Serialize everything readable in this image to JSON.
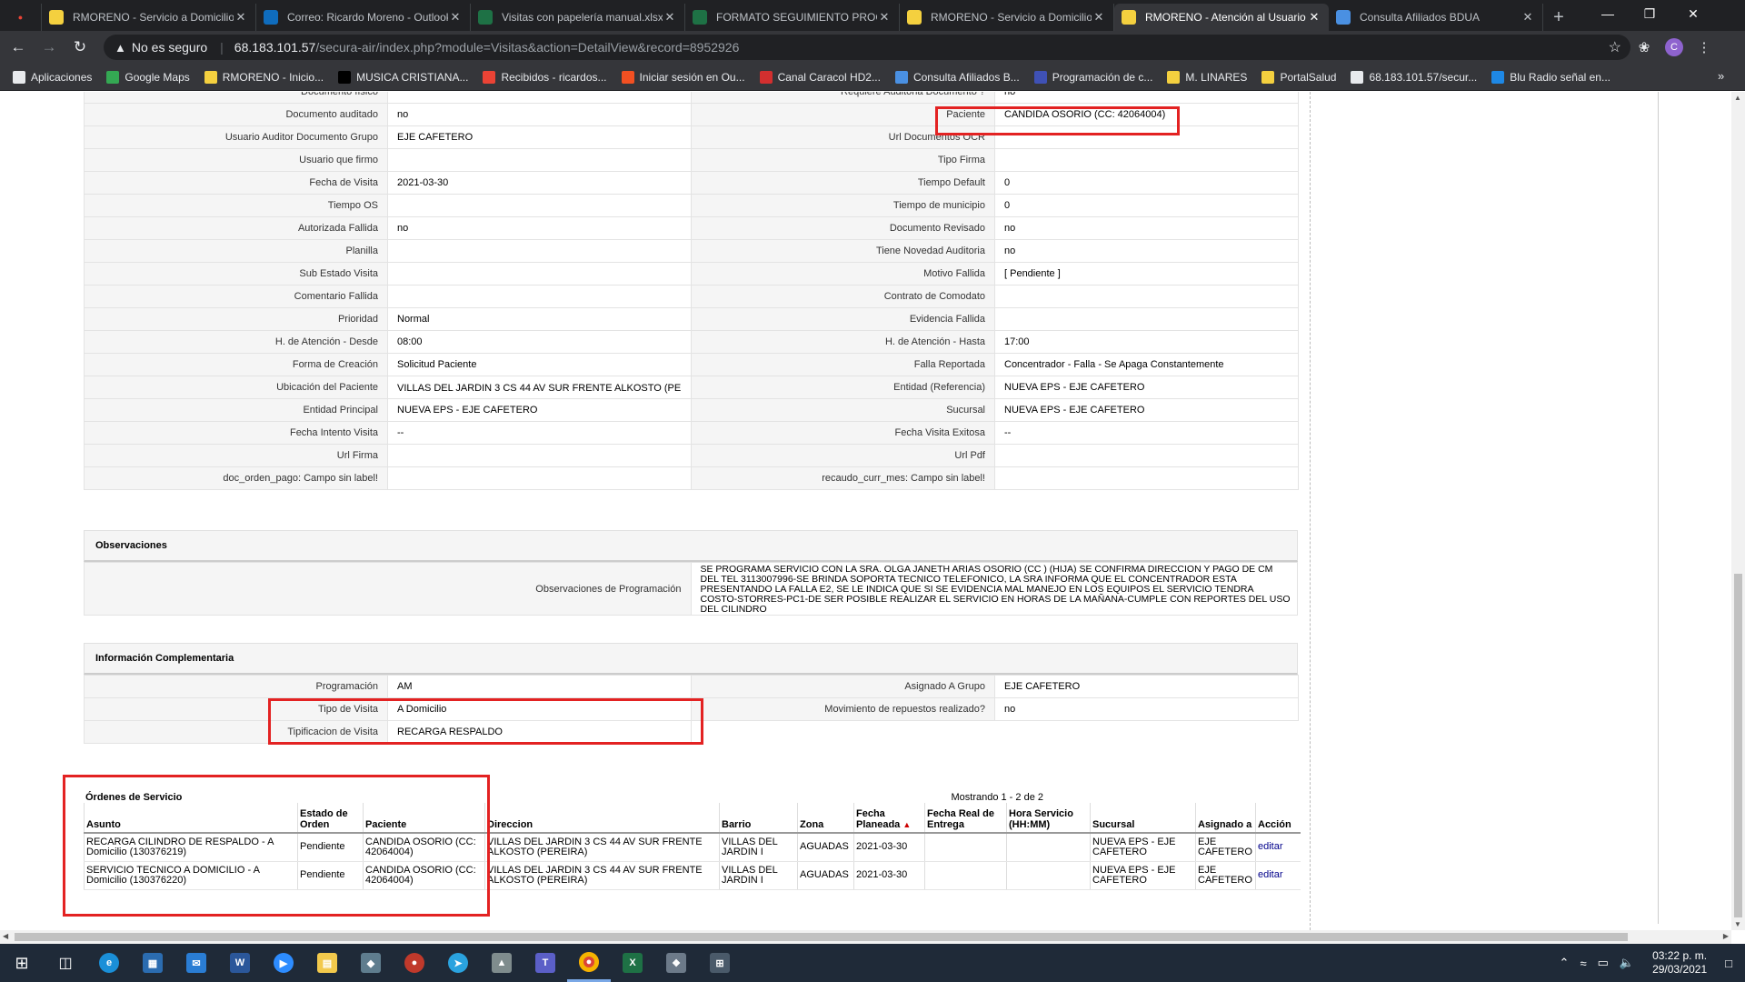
{
  "browser": {
    "tabs": [
      {
        "title": "RMORENO - Servicio a Domicilio",
        "icon": "yellow-logo",
        "color": "#f4d03f",
        "active": false
      },
      {
        "title": "Correo: Ricardo Moreno - Outlook",
        "icon": "outlook",
        "color": "#0f6cbd",
        "active": false
      },
      {
        "title": "Visitas con papelería manual.xlsx",
        "icon": "excel",
        "color": "#1e7145",
        "active": false
      },
      {
        "title": "FORMATO SEGUIMIENTO PROGRAMACIÓN",
        "icon": "excel",
        "color": "#1e7145",
        "active": false
      },
      {
        "title": "RMORENO - Servicio a Domicilio",
        "icon": "yellow-logo",
        "color": "#f4d03f",
        "active": false
      },
      {
        "title": "RMORENO - Atención al Usuario",
        "icon": "yellow-logo",
        "color": "#f4d03f",
        "active": true
      },
      {
        "title": "Consulta Afiliados BDUA",
        "icon": "adres",
        "color": "#4a90e2",
        "active": false
      }
    ],
    "address": {
      "security": "No es seguro",
      "host": "68.183.101.57",
      "path": "/secura-air/index.php?module=Visitas&action=DetailView&record=8952926"
    },
    "profile_initial": "C",
    "bookmarks": [
      {
        "label": "Aplicaciones",
        "icon": "apps-icon",
        "color": "#e8eaed"
      },
      {
        "label": "Google Maps",
        "icon": "maps-icon",
        "color": "#34a853"
      },
      {
        "label": "RMORENO - Inicio...",
        "icon": "yellow-logo",
        "color": "#f4d03f"
      },
      {
        "label": "MUSICA CRISTIANA...",
        "icon": "music-icon",
        "color": "#000000"
      },
      {
        "label": "Recibidos - ricardos...",
        "icon": "gmail-icon",
        "color": "#ea4335"
      },
      {
        "label": "Iniciar sesión en Ou...",
        "icon": "ms-icon",
        "color": "#f25022"
      },
      {
        "label": "Canal Caracol HD2...",
        "icon": "caracol-icon",
        "color": "#d32f2f"
      },
      {
        "label": "Consulta Afiliados B...",
        "icon": "adres-icon",
        "color": "#4a90e2"
      },
      {
        "label": "Programación de c...",
        "icon": "prog-icon",
        "color": "#3f51b5"
      },
      {
        "label": "M. LINARES",
        "icon": "yellow-logo",
        "color": "#f4d03f"
      },
      {
        "label": "PortalSalud",
        "icon": "portal-icon",
        "color": "#f4d03f"
      },
      {
        "label": "68.183.101.57/secur...",
        "icon": "globe-icon",
        "color": "#e8eaed"
      },
      {
        "label": "Blu Radio señal en...",
        "icon": "blu-icon",
        "color": "#1e88e5"
      }
    ]
  },
  "detail_rows": [
    {
      "l1": "Documento físico",
      "v1": "",
      "l2": "Requiere Auditoria Documento ?",
      "v2": "no"
    },
    {
      "l1": "Documento auditado",
      "v1": "no",
      "l2": "Paciente",
      "v2": "CANDIDA OSORIO (CC: 42064004)"
    },
    {
      "l1": "Usuario Auditor Documento Grupo",
      "v1": "EJE CAFETERO",
      "l2": "Url Documentos OCR",
      "v2": ""
    },
    {
      "l1": "Usuario que firmo",
      "v1": "",
      "l2": "Tipo Firma",
      "v2": ""
    },
    {
      "l1": "Fecha de Visita",
      "v1": "2021-03-30",
      "l2": "Tiempo Default",
      "v2": "0"
    },
    {
      "l1": "Tiempo OS",
      "v1": "",
      "l2": "Tiempo de municipio",
      "v2": "0"
    },
    {
      "l1": "Autorizada Fallida",
      "v1": "no",
      "l2": "Documento Revisado",
      "v2": "no"
    },
    {
      "l1": "Planilla",
      "v1": "",
      "l2": "Tiene Novedad Auditoria",
      "v2": "no"
    },
    {
      "l1": "Sub Estado Visita",
      "v1": "",
      "l2": "Motivo Fallida",
      "v2": "[ Pendiente ]"
    },
    {
      "l1": "Comentario Fallida",
      "v1": "",
      "l2": "Contrato de Comodato",
      "v2": ""
    },
    {
      "l1": "Prioridad",
      "v1": "Normal",
      "l2": "Evidencia Fallida",
      "v2": ""
    },
    {
      "l1": "H. de Atención - Desde",
      "v1": "08:00",
      "l2": "H. de Atención - Hasta",
      "v2": "17:00"
    },
    {
      "l1": "Forma de Creación",
      "v1": "Solicitud Paciente",
      "l2": "Falla Reportada",
      "v2": "Concentrador - Falla - Se Apaga Constantemente"
    },
    {
      "l1": "Ubicación del Paciente",
      "v1": "VILLAS DEL JARDIN 3 CS 44 AV SUR FRENTE ALKOSTO (PE",
      "l2": "Entidad (Referencia)",
      "v2": "NUEVA EPS - EJE CAFETERO"
    },
    {
      "l1": "Entidad Principal",
      "v1": "NUEVA EPS - EJE CAFETERO",
      "l2": "Sucursal",
      "v2": "NUEVA EPS - EJE CAFETERO"
    },
    {
      "l1": "Fecha Intento Visita",
      "v1": "--",
      "l2": "Fecha Visita Exitosa",
      "v2": "--"
    },
    {
      "l1": "Url Firma",
      "v1": "",
      "l2": "Url Pdf",
      "v2": ""
    },
    {
      "l1": "doc_orden_pago: Campo sin label!",
      "v1": "",
      "l2": "recaudo_curr_mes: Campo sin label!",
      "v2": ""
    }
  ],
  "observaciones": {
    "header": "Observaciones",
    "label": "Observaciones de Programación",
    "text": " SE PROGRAMA SERVICIO CON LA SRA. OLGA JANETH ARIAS OSORIO (CC ) (HIJA) SE CONFIRMA DIRECCION Y PAGO DE CM DEL TEL 3113007996-SE BRINDA SOPORTA TECNICO TELEFONICO, LA SRA INFORMA QUE EL CONCENTRADOR ESTA PRESENTANDO LA FALLA E2, SE LE INDICA QUE SI SE EVIDENCIA MAL MANEJO EN LOS EQUIPOS EL SERVICIO TENDRA COSTO-STORRES-PC1-DE SER POSIBLE REALIZAR EL SERVICIO EN HORAS DE LA MAÑANA-CUMPLE CON REPORTES DEL USO DEL CILINDRO"
  },
  "info_complementaria": {
    "header": "Información Complementaria",
    "rows": [
      {
        "l1": "Programación",
        "v1": "AM",
        "l2": "Asignado A Grupo",
        "v2": "EJE CAFETERO"
      },
      {
        "l1": "Tipo de Visita",
        "v1": "A Domicilio",
        "l2": "Movimiento de repuestos realizado?",
        "v2": "no"
      }
    ],
    "tipificacion_label": "Tipificacion de Visita",
    "tipificacion_value": "RECARGA RESPALDO"
  },
  "ordenes": {
    "title": "Órdenes de Servicio",
    "pager": "Mostrando 1 - 2 de 2",
    "columns": [
      "Asunto",
      "Estado de Orden",
      "Paciente",
      "Direccion",
      "Barrio",
      "Zona",
      "Fecha Planeada",
      "Fecha Real de Entrega",
      "Hora Servicio (HH:MM)",
      "Sucursal",
      "Asignado a",
      "Acción"
    ],
    "sort_indicator": "▲",
    "rows": [
      {
        "asunto": "RECARGA CILINDRO DE RESPALDO - A Domicilio (130376219)",
        "estado": "Pendiente",
        "paciente": "CANDIDA OSORIO (CC: 42064004)",
        "direccion": "VILLAS DEL JARDIN 3 CS 44 AV SUR FRENTE ALKOSTO (PEREIRA)",
        "barrio": "VILLAS DEL JARDIN I",
        "zona": "AGUADAS",
        "fecha_planeada": "2021-03-30",
        "fecha_real": "",
        "hora": "",
        "sucursal": "NUEVA EPS - EJE CAFETERO",
        "asignado": "EJE CAFETERO",
        "accion": "editar"
      },
      {
        "asunto": "SERVICIO TECNICO A DOMICILIO - A Domicilio (130376220)",
        "estado": "Pendiente",
        "paciente": "CANDIDA OSORIO (CC: 42064004)",
        "direccion": "VILLAS DEL JARDIN 3 CS 44 AV SUR FRENTE ALKOSTO (PEREIRA)",
        "barrio": "VILLAS DEL JARDIN I",
        "zona": "AGUADAS",
        "fecha_planeada": "2021-03-30",
        "fecha_real": "",
        "hora": "",
        "sucursal": "NUEVA EPS - EJE CAFETERO",
        "asignado": "EJE CAFETERO",
        "accion": "editar"
      }
    ]
  },
  "taskbar": {
    "time": "03:22 p. m.",
    "date": "29/03/2021"
  },
  "colors": {
    "highlight": "#e32222",
    "link": "#00008b"
  }
}
